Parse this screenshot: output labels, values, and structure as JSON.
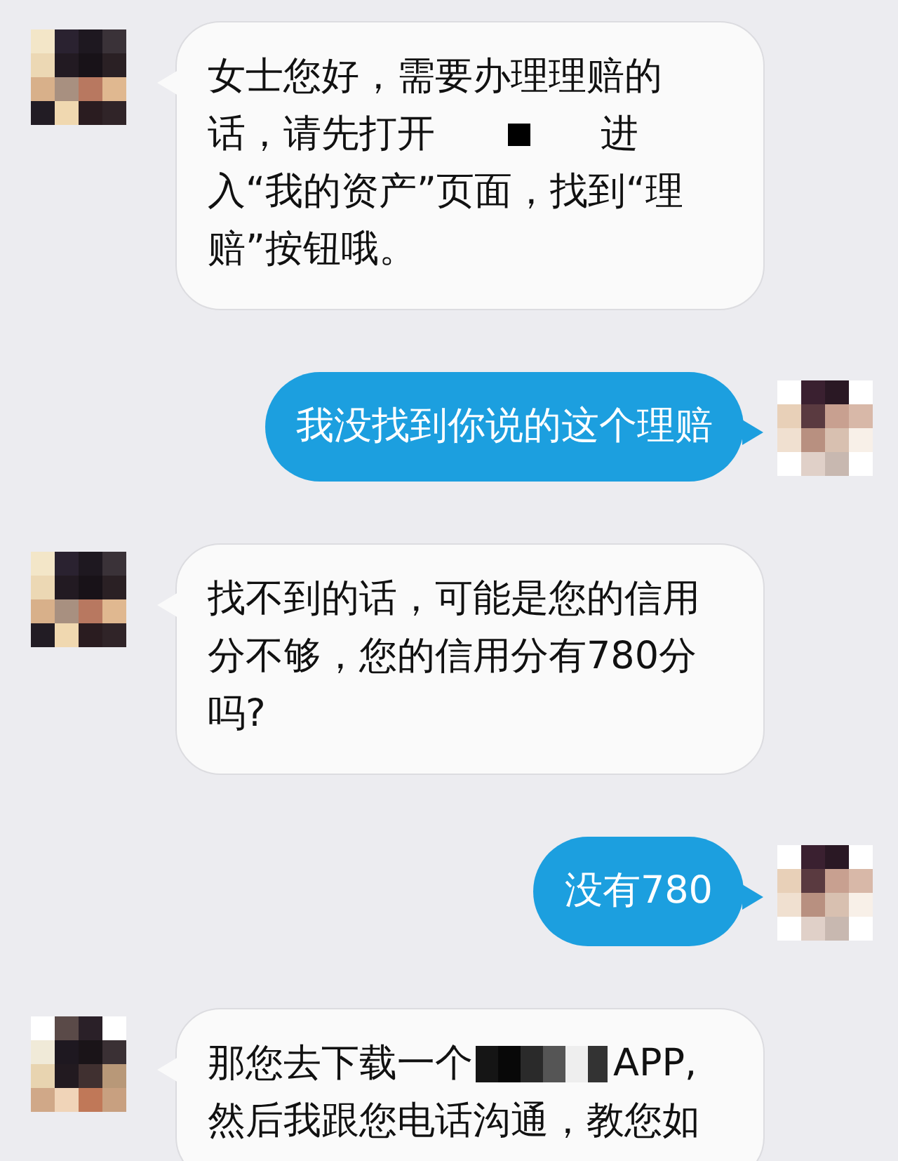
{
  "messages": [
    {
      "kind": "received",
      "lines": [
        [
          {
            "kind": "text",
            "text": "女士您好，需要办理理赔的"
          }
        ],
        [
          {
            "kind": "text",
            "text": "话，请先打开"
          },
          {
            "kind": "blank"
          },
          {
            "kind": "text",
            "text": "进"
          }
        ],
        [
          {
            "kind": "text",
            "text": "入“我的资产”页面，找到“理"
          }
        ],
        [
          {
            "kind": "text",
            "text": "赔”按钮哦。"
          }
        ]
      ]
    },
    {
      "kind": "sent",
      "lines": [
        [
          {
            "kind": "text",
            "text": "我没找到你说的这个理赔"
          }
        ]
      ]
    },
    {
      "kind": "received",
      "lines": [
        [
          {
            "kind": "text",
            "text": "找不到的话，可能是您的信用"
          }
        ],
        [
          {
            "kind": "text",
            "text": "分不够，您的信用分有780分"
          }
        ],
        [
          {
            "kind": "text",
            "text": "吗?"
          }
        ]
      ]
    },
    {
      "kind": "sent",
      "lines": [
        [
          {
            "kind": "text",
            "text": "没有780"
          }
        ]
      ]
    },
    {
      "kind": "received",
      "lines": [
        [
          {
            "kind": "text",
            "text": "那您去下载一个"
          },
          {
            "kind": "mosaic"
          },
          {
            "kind": "text",
            "text": "APP,"
          }
        ],
        [
          {
            "kind": "text",
            "text": "然后我跟您电话沟通，教您如"
          }
        ]
      ]
    }
  ]
}
